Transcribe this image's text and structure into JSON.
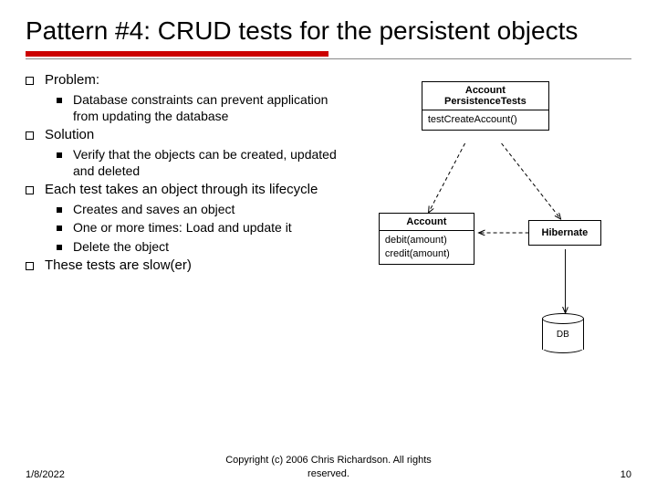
{
  "title": "Pattern #4: CRUD tests for the persistent objects",
  "bullets": {
    "b1": "Problem:",
    "b1_1": "Database constraints can prevent application from updating the database",
    "b2": "Solution",
    "b2_1": "Verify that the objects can be created, updated and deleted",
    "b3": "Each test takes an object through its lifecycle",
    "b3_1": "Creates and saves an object",
    "b3_2": "One or more times: Load and update it",
    "b3_3": "Delete the object",
    "b4": "These tests are slow(er)"
  },
  "diagram": {
    "class1": "Account PersistenceTests",
    "class1_op": "testCreateAccount()",
    "class2": "Account",
    "class2_op1": "debit(amount)",
    "class2_op2": "credit(amount)",
    "class3": "Hibernate",
    "db": "DB"
  },
  "footer": {
    "date": "1/8/2022",
    "copyright": "Copyright (c)  2006 Chris Richardson. All rights reserved.",
    "page": "10"
  }
}
